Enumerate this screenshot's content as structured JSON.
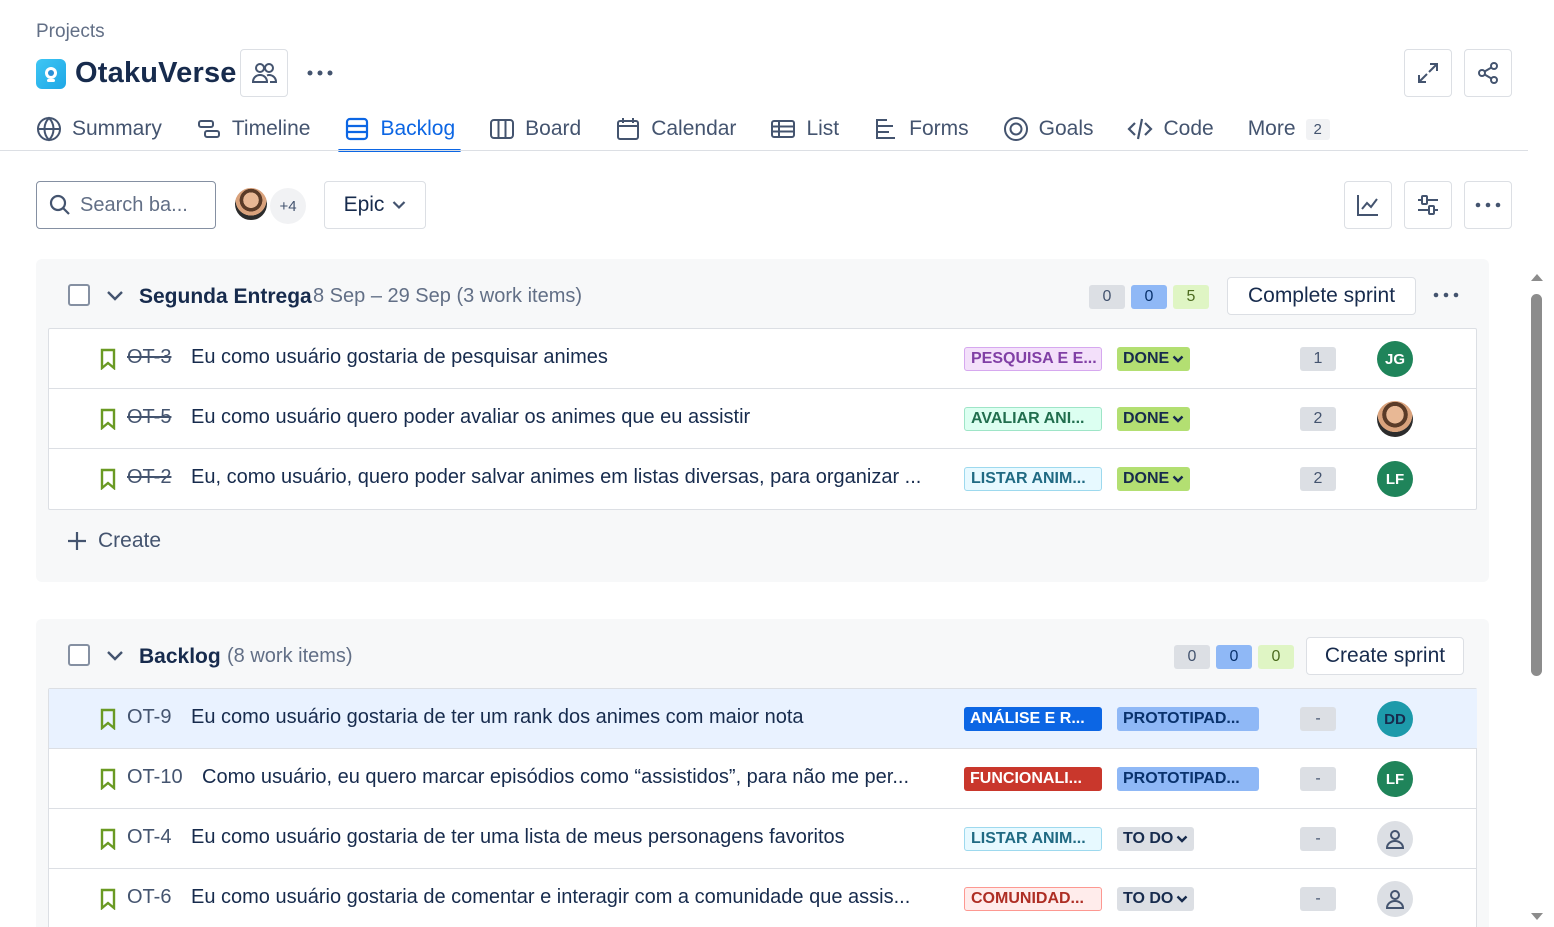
{
  "breadcrumb": "Projects",
  "project": {
    "name": "OtakuVerse"
  },
  "tabs": [
    {
      "label": "Summary",
      "icon": "globe-icon"
    },
    {
      "label": "Timeline",
      "icon": "timeline-icon"
    },
    {
      "label": "Backlog",
      "icon": "backlog-icon",
      "active": true
    },
    {
      "label": "Board",
      "icon": "board-icon"
    },
    {
      "label": "Calendar",
      "icon": "calendar-icon"
    },
    {
      "label": "List",
      "icon": "list-icon"
    },
    {
      "label": "Forms",
      "icon": "forms-icon"
    },
    {
      "label": "Goals",
      "icon": "goals-icon"
    },
    {
      "label": "Code",
      "icon": "code-icon"
    },
    {
      "label": "More",
      "count": "2"
    }
  ],
  "toolbar": {
    "search_placeholder": "Search ba...",
    "avatars_more": "+4",
    "epic_label": "Epic"
  },
  "sprint": {
    "name": "Segunda Entrega",
    "meta": "8 Sep – 29 Sep (3 work items)",
    "counts": {
      "todo": "0",
      "in_progress": "0",
      "done": "5"
    },
    "complete_label": "Complete sprint",
    "create_label": "Create",
    "items": [
      {
        "key": "OT-3",
        "summary": "Eu como usuário gostaria de pesquisar animes",
        "epic": "PESQUISA E E...",
        "epic_bg": "#f3e0fa",
        "epic_fg": "#803fa5",
        "status": "DONE",
        "points": "1",
        "assignee": "JG",
        "assignee_bg": "#1f845a"
      },
      {
        "key": "OT-5",
        "summary": "Eu como usuário quero poder avaliar os animes que eu assistir",
        "epic": "AVALIAR ANI...",
        "epic_bg": "#dcfff1",
        "epic_fg": "#216e4e",
        "status": "DONE",
        "points": "2",
        "assignee": "",
        "assignee_bg": ""
      },
      {
        "key": "OT-2",
        "summary": "Eu, como usuário, quero poder salvar animes em listas diversas, para organizar ...",
        "epic": "LISTAR ANIM...",
        "epic_bg": "#e7f9ff",
        "epic_fg": "#206a83",
        "status": "DONE",
        "points": "2",
        "assignee": "LF",
        "assignee_bg": "#1f845a"
      }
    ]
  },
  "backlog": {
    "name": "Backlog",
    "meta": "(8 work items)",
    "counts": {
      "todo": "0",
      "in_progress": "0",
      "done": "0"
    },
    "create_sprint_label": "Create sprint",
    "items": [
      {
        "key": "OT-9",
        "summary": "Eu como usuário gostaria de ter um rank dos animes com maior nota",
        "epic": "ANÁLISE E R...",
        "epic_bg": "#0c66e4",
        "epic_fg": "#ffffff",
        "status": "PROTOTIPAD...",
        "points": "-",
        "assignee": "DD",
        "assignee_bg": "#1d9aaa"
      },
      {
        "key": "OT-10",
        "summary": "Como usuário, eu quero marcar episódios como “assistidos”, para não me per...",
        "epic": "FUNCIONALI...",
        "epic_bg": "#c9372c",
        "epic_fg": "#ffffff",
        "status": "PROTOTIPAD...",
        "points": "-",
        "assignee": "LF",
        "assignee_bg": "#1f845a"
      },
      {
        "key": "OT-4",
        "summary": "Eu como usuário gostaria de ter uma lista de meus personagens favoritos",
        "epic": "LISTAR ANIM...",
        "epic_bg": "#e7f9ff",
        "epic_fg": "#206a83",
        "status": "TO DO",
        "points": "-",
        "assignee": "",
        "assignee_bg": ""
      },
      {
        "key": "OT-6",
        "summary": "Eu como usuário gostaria de comentar e interagir com a comunidade que assis...",
        "epic": "COMUNIDAD...",
        "epic_bg": "#ffeceb",
        "epic_fg": "#ae2e24",
        "status": "TO DO",
        "points": "-",
        "assignee": "",
        "assignee_bg": ""
      }
    ]
  },
  "colors": {
    "accent": "#0c66e4",
    "done_status": "#b3df72",
    "prototype_status": "#8fb8f6",
    "todo_status": "#dcdfe4"
  }
}
